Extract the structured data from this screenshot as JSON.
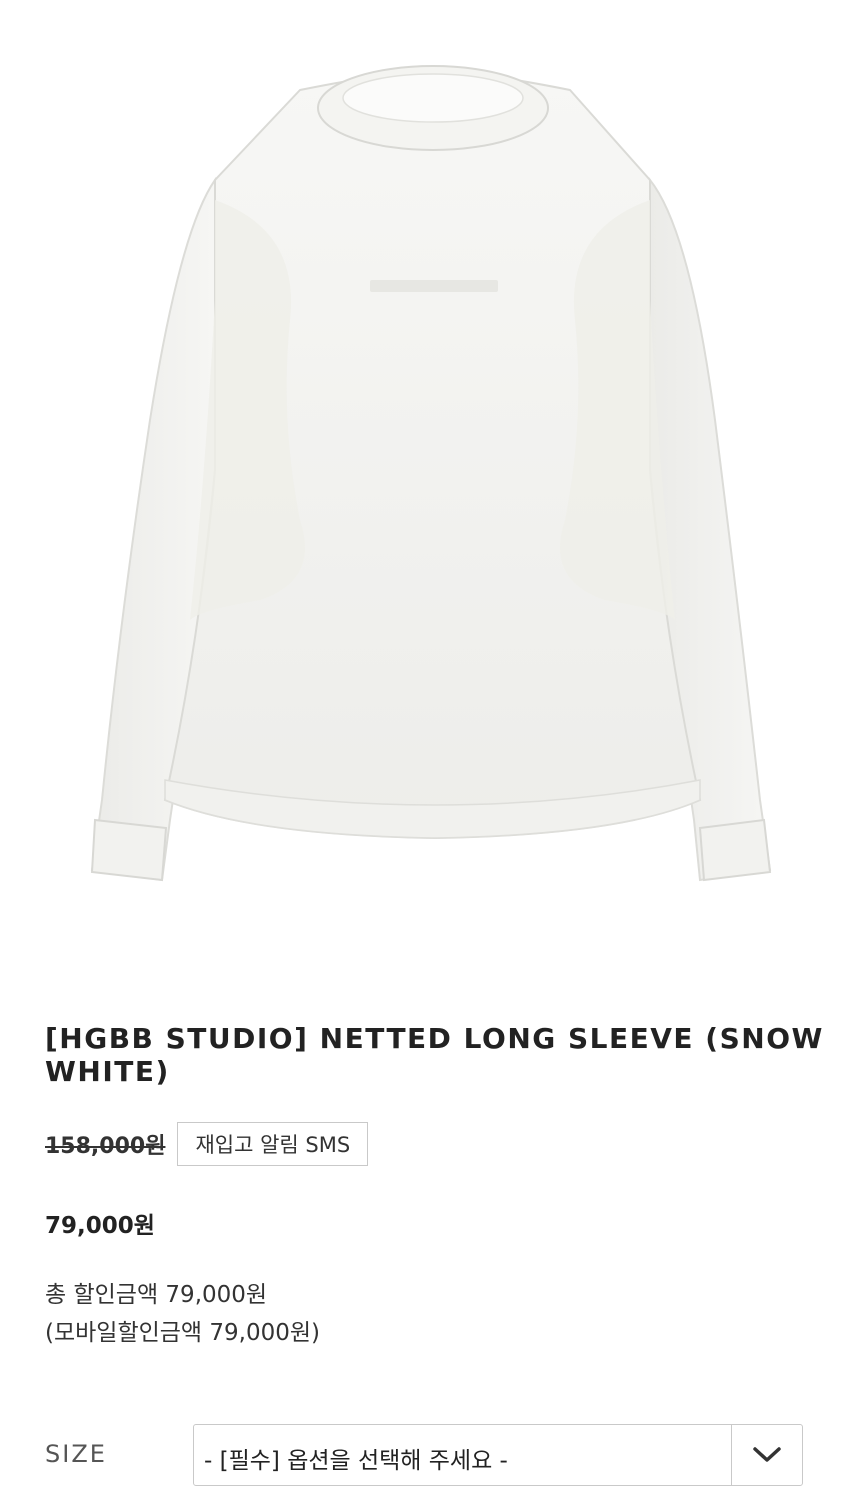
{
  "product": {
    "title": "[HGBB STUDIO] NETTED LONG SLEEVE (SNOW WHITE)",
    "image_alt": "white long sleeve shirt",
    "original_price": "158,000원",
    "restock_sms_label": "재입고 알림 SMS",
    "sale_price": "79,000원",
    "total_discount": "총 할인금액 79,000원",
    "mobile_discount": "(모바일할인금액 79,000원)"
  },
  "option": {
    "label": "SIZE",
    "selected_text": "- [필수] 옵션을 선택해 주세요 -"
  },
  "colors": {
    "background": "#ffffff",
    "text": "#222222",
    "border": "#c9c9c9"
  }
}
